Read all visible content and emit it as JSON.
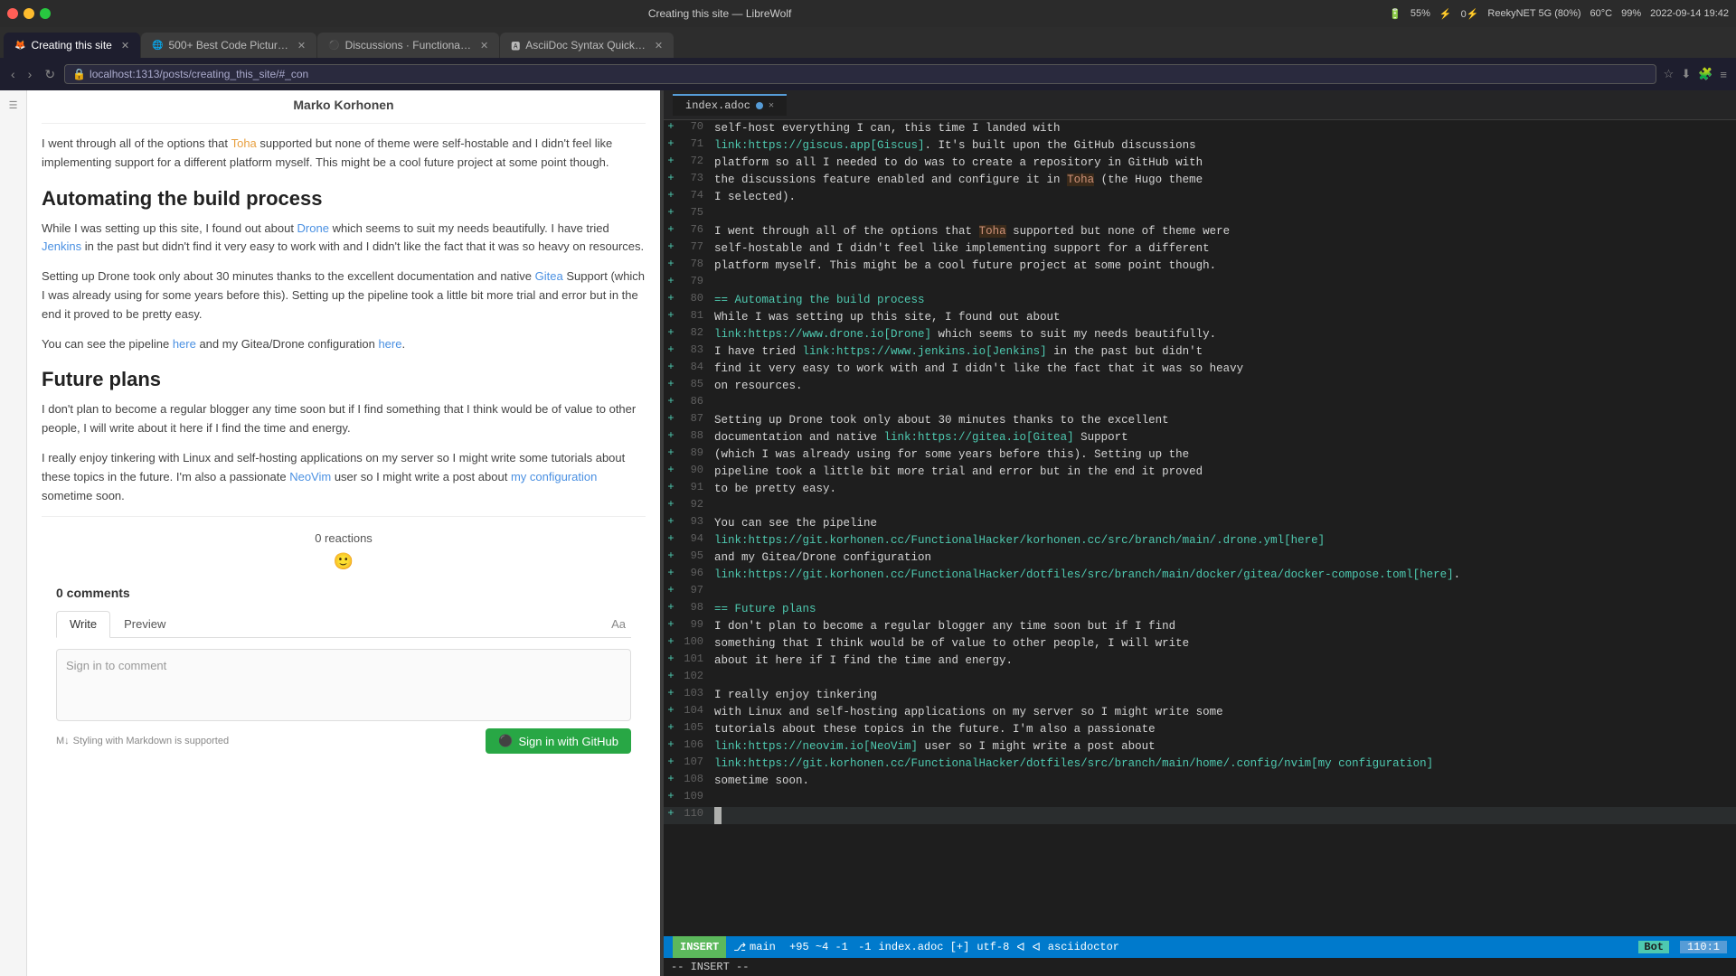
{
  "window": {
    "title": "Creating this site — LibreWolf"
  },
  "tabs": [
    {
      "id": "tab1",
      "label": "Creating this site",
      "active": true,
      "favicon": "🦊"
    },
    {
      "id": "tab2",
      "label": "500+ Best Code Pictur…",
      "active": false,
      "favicon": "🌐"
    },
    {
      "id": "tab3",
      "label": "Discussions · Functiona…",
      "active": false,
      "favicon": "⚫"
    },
    {
      "id": "tab4",
      "label": "AsciiDoc Syntax Quick…",
      "active": false,
      "favicon": "🅰"
    }
  ],
  "url_bar": {
    "url": "localhost:1313/posts/creating_this_site/#_con"
  },
  "system_status": {
    "battery": "55%",
    "power": "0⚡",
    "wifi": "ReekyNET 5G (80%)",
    "temp": "60°C",
    "batt2": "99%",
    "datetime": "2022-09-14 19:42"
  },
  "browser_content": {
    "author": "Marko Korhonen",
    "body_paragraphs": [
      "I went through all of the options that Toha supported but none of theme were self-hostable and I didn't feel like implementing support for a different platform myself. This might be a cool future project at some point though."
    ],
    "sections": [
      {
        "heading": "Automating the build process",
        "paragraphs": [
          "While I was setting up this site, I found out about Drone which seems to suit my needs beautifully. I have tried Jenkins in the past but didn't find it very easy to work with and I didn't like the fact that it was so heavy on resources.",
          "Setting up Drone took only about 30 minutes thanks to the excellent documentation and native Gitea Support (which I was already using for some years before this). Setting up the pipeline took a little bit more trial and error but in the end it proved to be pretty easy.",
          "You can see the pipeline here and my Gitea/Drone configuration here."
        ]
      },
      {
        "heading": "Future plans",
        "paragraphs": [
          "I don't plan to become a regular blogger any time soon but if I find something that I think would be of value to other people, I will write about it here if I find the time and energy.",
          "I really enjoy tinkering with Linux and self-hosting applications on my server so I might write some tutorials about these topics in the future. I'm also a passionate NeoVim user so I might write a post about my configuration sometime soon."
        ]
      }
    ],
    "reactions": {
      "count": "0 reactions"
    },
    "comments": {
      "count": "0 comments",
      "tabs": [
        "Write",
        "Preview"
      ],
      "active_tab": "Write",
      "placeholder": "Sign in to comment",
      "markdown_note": "Styling with Markdown is supported",
      "sign_in_btn": "Sign in with GitHub"
    }
  },
  "editor": {
    "filename": "index.adoc",
    "lines": [
      {
        "num": 70,
        "plus": true,
        "content": "self-host everything I can, this time I landed with"
      },
      {
        "num": 71,
        "plus": true,
        "content": "link:https://giscus.app[Giscus]. It's built upon the GitHub discussions",
        "has_link": true,
        "link_text": "https://giscus.app[Giscus]"
      },
      {
        "num": 72,
        "plus": true,
        "content": "platform so all I needed to do was to create a repository in GitHub with"
      },
      {
        "num": 73,
        "plus": true,
        "content": "the discussions feature enabled and configure it in Toha (the Hugo theme",
        "has_highlight": true,
        "highlight": "Toha"
      },
      {
        "num": 74,
        "plus": true,
        "content": "I selected)."
      },
      {
        "num": 75,
        "plus": true,
        "content": ""
      },
      {
        "num": 76,
        "plus": true,
        "content": "I went through all of the options that Toha supported but none of theme were",
        "has_highlight": true,
        "highlight": "Toha"
      },
      {
        "num": 77,
        "plus": true,
        "content": "self-hostable and I didn't feel like implementing support for a different"
      },
      {
        "num": 78,
        "plus": true,
        "content": "platform myself. This might be a cool future project at some point though."
      },
      {
        "num": 79,
        "plus": true,
        "content": ""
      },
      {
        "num": 80,
        "plus": true,
        "content": "== Automating the build process",
        "is_heading": true
      },
      {
        "num": 81,
        "plus": true,
        "content": "While I was setting up this site, I found out about"
      },
      {
        "num": 82,
        "plus": true,
        "content": "link:https://www.drone.io[Drone] which seems to suit my needs beautifully.",
        "has_link": true
      },
      {
        "num": 83,
        "plus": true,
        "content": "I have tried link:https://www.jenkins.io[Jenkins] in the past but didn't",
        "has_link": true
      },
      {
        "num": 84,
        "plus": true,
        "content": "find it very easy to work with and I didn't like the fact that it was so heavy"
      },
      {
        "num": 85,
        "plus": true,
        "content": "on resources."
      },
      {
        "num": 86,
        "plus": true,
        "content": ""
      },
      {
        "num": 87,
        "plus": true,
        "content": "Setting up Drone took only about 30 minutes thanks to the excellent"
      },
      {
        "num": 88,
        "plus": true,
        "content": "documentation and native link:https://gitea.io[Gitea] Support",
        "has_link": true
      },
      {
        "num": 89,
        "plus": true,
        "content": "(which I was already using for some years before this). Setting up the"
      },
      {
        "num": 90,
        "plus": true,
        "content": "pipeline took a little bit more trial and error but in the end it proved"
      },
      {
        "num": 91,
        "plus": true,
        "content": "to be pretty easy."
      },
      {
        "num": 92,
        "plus": true,
        "content": ""
      },
      {
        "num": 93,
        "plus": true,
        "content": "You can see the pipeline"
      },
      {
        "num": 94,
        "plus": true,
        "content": "link:https://git.korhonen.cc/FunctionalHacker/korhonen.cc/src/branch/main/.drone.yml[here]",
        "has_link": true
      },
      {
        "num": 95,
        "plus": true,
        "content": "and my Gitea/Drone configuration"
      },
      {
        "num": 96,
        "plus": true,
        "content": "link:https://git.korhonen.cc/FunctionalHacker/dotfiles/src/branch/main/docker/gitea/docker-compose.toml[here].",
        "has_link": true
      },
      {
        "num": 97,
        "plus": true,
        "content": ""
      },
      {
        "num": 98,
        "plus": true,
        "content": "== Future plans",
        "is_heading": true
      },
      {
        "num": 99,
        "plus": true,
        "content": "I don't plan to become a regular blogger any time soon but if I find"
      },
      {
        "num": 100,
        "plus": true,
        "content": "something that I think would be of value to other people, I will write"
      },
      {
        "num": 101,
        "plus": true,
        "content": "about it here if I find the time and energy."
      },
      {
        "num": 102,
        "plus": true,
        "content": ""
      },
      {
        "num": 103,
        "plus": true,
        "content": "I really enjoy tinkering"
      },
      {
        "num": 104,
        "plus": true,
        "content": "with Linux and self-hosting applications on my server so I might write some"
      },
      {
        "num": 105,
        "plus": true,
        "content": "tutorials about these topics in the future. I'm also a passionate"
      },
      {
        "num": 106,
        "plus": true,
        "content": "link:https://neovim.io[NeoVim] user so I might write a post about",
        "has_link": true
      },
      {
        "num": 107,
        "plus": true,
        "content": "link:https://git.korhonen.cc/FunctionalHacker/dotfiles/src/branch/main/home/.config/nvim[my configuration]",
        "has_link": true
      },
      {
        "num": 108,
        "plus": true,
        "content": "sometime soon."
      },
      {
        "num": 109,
        "plus": true,
        "content": ""
      },
      {
        "num": 110,
        "plus": true,
        "content": "",
        "is_cursor": true
      }
    ],
    "status": {
      "mode": "INSERT",
      "branch": "main",
      "stats": "+95 ~4 -1",
      "filename": "index.adoc [+]",
      "encoding": "utf-8",
      "filetype": "asciidoctor",
      "bot_label": "Bot",
      "position": "110:1"
    },
    "cmd": "-- INSERT --"
  }
}
